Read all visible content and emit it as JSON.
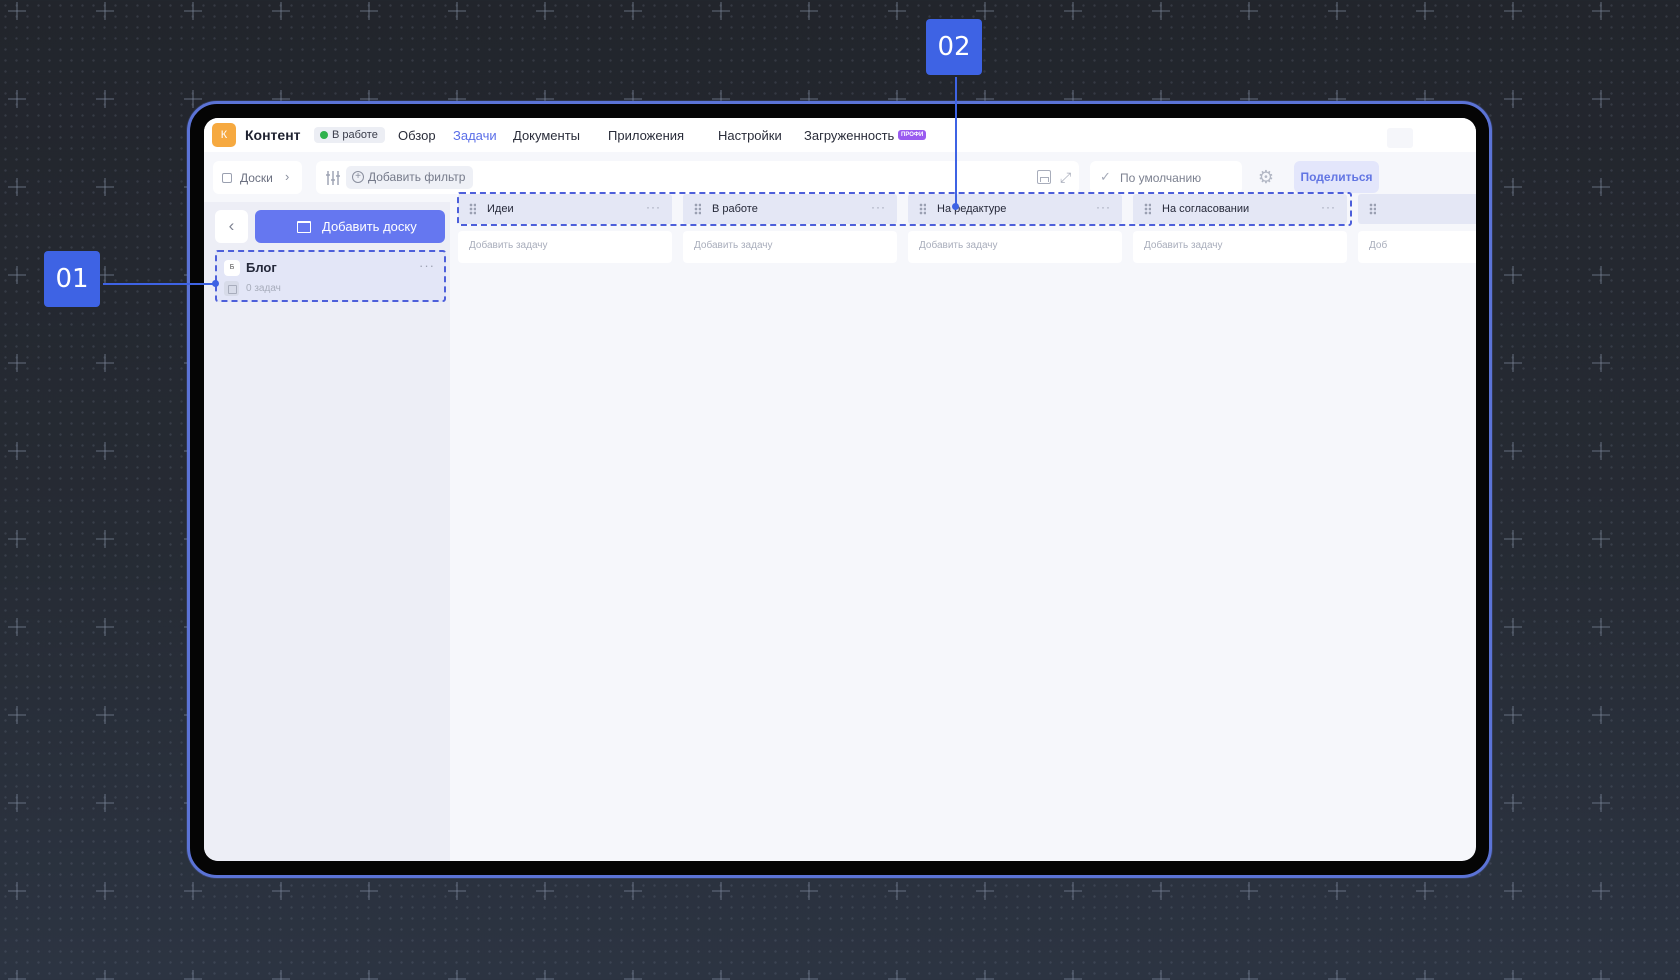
{
  "app": {
    "logo_letter": "К",
    "title": "Контент",
    "status": "В работе"
  },
  "nav": {
    "tabs": [
      "Обзор",
      "Задачи",
      "Документы",
      "Приложения",
      "Настройки",
      "Загруженность"
    ],
    "active_tab": "Задачи",
    "pro_badge": "ПРОФИ"
  },
  "toolbar": {
    "boards_label": "Доски",
    "add_filter_label": "Добавить фильтр",
    "view_label": "По умолчанию",
    "share_label": "Поделиться"
  },
  "sidebar": {
    "add_board_label": "Добавить доску",
    "boards": [
      {
        "tag": "Б",
        "name": "Блог",
        "count": "0 задач"
      }
    ]
  },
  "columns": [
    {
      "name": "Идеи",
      "add_task": "Добавить задачу"
    },
    {
      "name": "В работе",
      "add_task": "Добавить задачу"
    },
    {
      "name": "На редактуре",
      "add_task": "Добавить задачу"
    },
    {
      "name": "На согласовании",
      "add_task": "Добавить задачу"
    },
    {
      "name": "",
      "add_task": "Доб"
    }
  ],
  "callouts": [
    "01",
    "02"
  ],
  "colors": {
    "accent": "#6577f0",
    "callout": "#3e63e4",
    "status_dot": "#2fb24c",
    "logo": "#f6a940",
    "pro_badge": "#9a5bf0"
  },
  "icons": [
    "chevron-left-icon",
    "chevron-right-icon",
    "sliders-icon",
    "plus-circle-icon",
    "save-icon",
    "expand-icon",
    "check-icon",
    "gear-icon",
    "board-icon",
    "grip-icon",
    "more-icon"
  ]
}
